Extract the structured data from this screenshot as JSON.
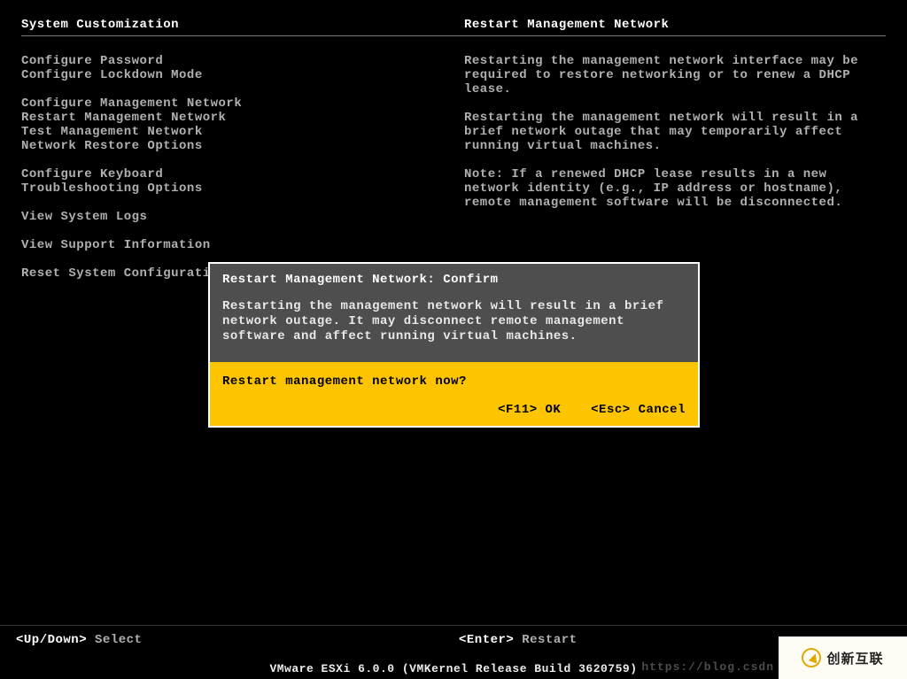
{
  "headers": {
    "left": "System Customization",
    "right": "Restart Management Network"
  },
  "menu": {
    "group1": [
      "Configure Password",
      "Configure Lockdown Mode"
    ],
    "group2": [
      "Configure Management Network",
      "Restart Management Network",
      "Test Management Network",
      "Network Restore Options"
    ],
    "group3": [
      "Configure Keyboard",
      "Troubleshooting Options"
    ],
    "group4": [
      "View System Logs"
    ],
    "group5": [
      "View Support Information"
    ],
    "group6": [
      "Reset System Configuration"
    ]
  },
  "desc": {
    "p1": "Restarting the management network interface may be required to restore networking or to renew a DHCP lease.",
    "p2": "Restarting the management network will result in a brief network outage that may temporarily affect running virtual machines.",
    "p3": "Note: If a renewed DHCP lease results in a new network identity (e.g., IP address or hostname), remote management software will be disconnected."
  },
  "dialog": {
    "title": "Restart Management Network: Confirm",
    "body": "Restarting the management network will result in a brief network outage. It may disconnect remote management software and affect running virtual machines.",
    "question": "Restart management network now?",
    "ok_key": "<F11>",
    "ok_label": "OK",
    "cancel_key": "<Esc>",
    "cancel_label": "Cancel"
  },
  "footer": {
    "left_key": "<Up/Down>",
    "left_label": "Select",
    "right_key": "<Enter>",
    "right_label": "Restart"
  },
  "bottom": "VMware ESXi 6.0.0 (VMKernel Release Build 3620759)",
  "brand": "创新互联",
  "faint_url": "https://blog.csdn"
}
